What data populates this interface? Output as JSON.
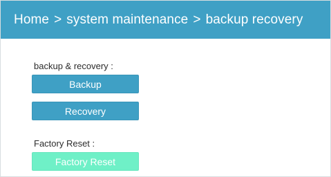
{
  "header": {
    "breadcrumb": [
      "Home",
      "system maintenance",
      "backup recovery"
    ],
    "separator": ">"
  },
  "backup_section": {
    "label": "backup & recovery :",
    "backup_button": "Backup",
    "recovery_button": "Recovery"
  },
  "factory_section": {
    "label": "Factory Reset :",
    "reset_button": "Factory Reset"
  },
  "colors": {
    "header_bg": "#3fa0c5",
    "primary_button": "#3fa0c5",
    "reset_button": "#6ff0c7"
  }
}
